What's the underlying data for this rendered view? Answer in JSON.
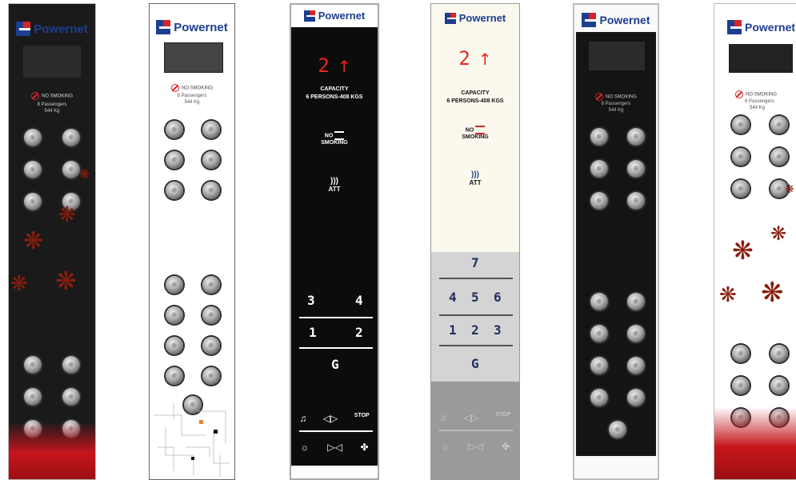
{
  "brand": {
    "name": "Powernet",
    "colors": {
      "blue": "#1d3e8f",
      "red": "#d8232a"
    }
  },
  "no_smoking": "NO SMOKING",
  "passengers": "8 Passengers",
  "weight": "544 Kg",
  "touch_panel": {
    "floor_display": "2",
    "direction_icon": "arrow-up-icon",
    "capacity_title": "CAPACITY",
    "capacity_value": "6 PERSONS-408 KGS",
    "no_label": "NO",
    "smoking_label": "SMOKING",
    "att_label": "ATT"
  },
  "panel3_floors": {
    "row1": [
      "3",
      "4"
    ],
    "row2": [
      "1",
      "2"
    ],
    "row3": [
      "G"
    ]
  },
  "panel4_floors": {
    "row0": [
      "7"
    ],
    "row1": [
      "4",
      "5",
      "6"
    ],
    "row2": [
      "1",
      "2",
      "3"
    ],
    "row3": [
      "G"
    ]
  },
  "controls": {
    "alarm_icon": "bell-icon",
    "door_open_icon": "door-open-icon",
    "stop_label": "STOP",
    "light_icon": "light-icon",
    "door_close_icon": "door-close-icon",
    "fan_icon": "fan-icon"
  }
}
